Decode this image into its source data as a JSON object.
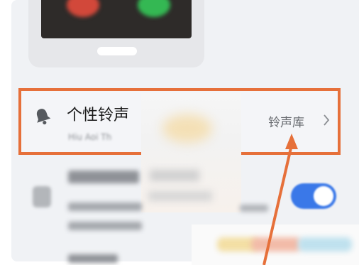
{
  "ringtone_row": {
    "title": "个性铃声",
    "subtitle": "Hiu Aoi Th",
    "library_label": "铃声库",
    "chevron": "›"
  },
  "icons": {
    "bell": "bell-icon",
    "chevron": "chevron-right-icon",
    "shield": "shield-icon"
  },
  "toggle": {
    "state": "on"
  },
  "colors": {
    "highlight_border": "#e6703a",
    "annotation_arrow": "#e6703a",
    "toggle_on": "#3a78e8",
    "panel_background": "#f0f2f5"
  }
}
